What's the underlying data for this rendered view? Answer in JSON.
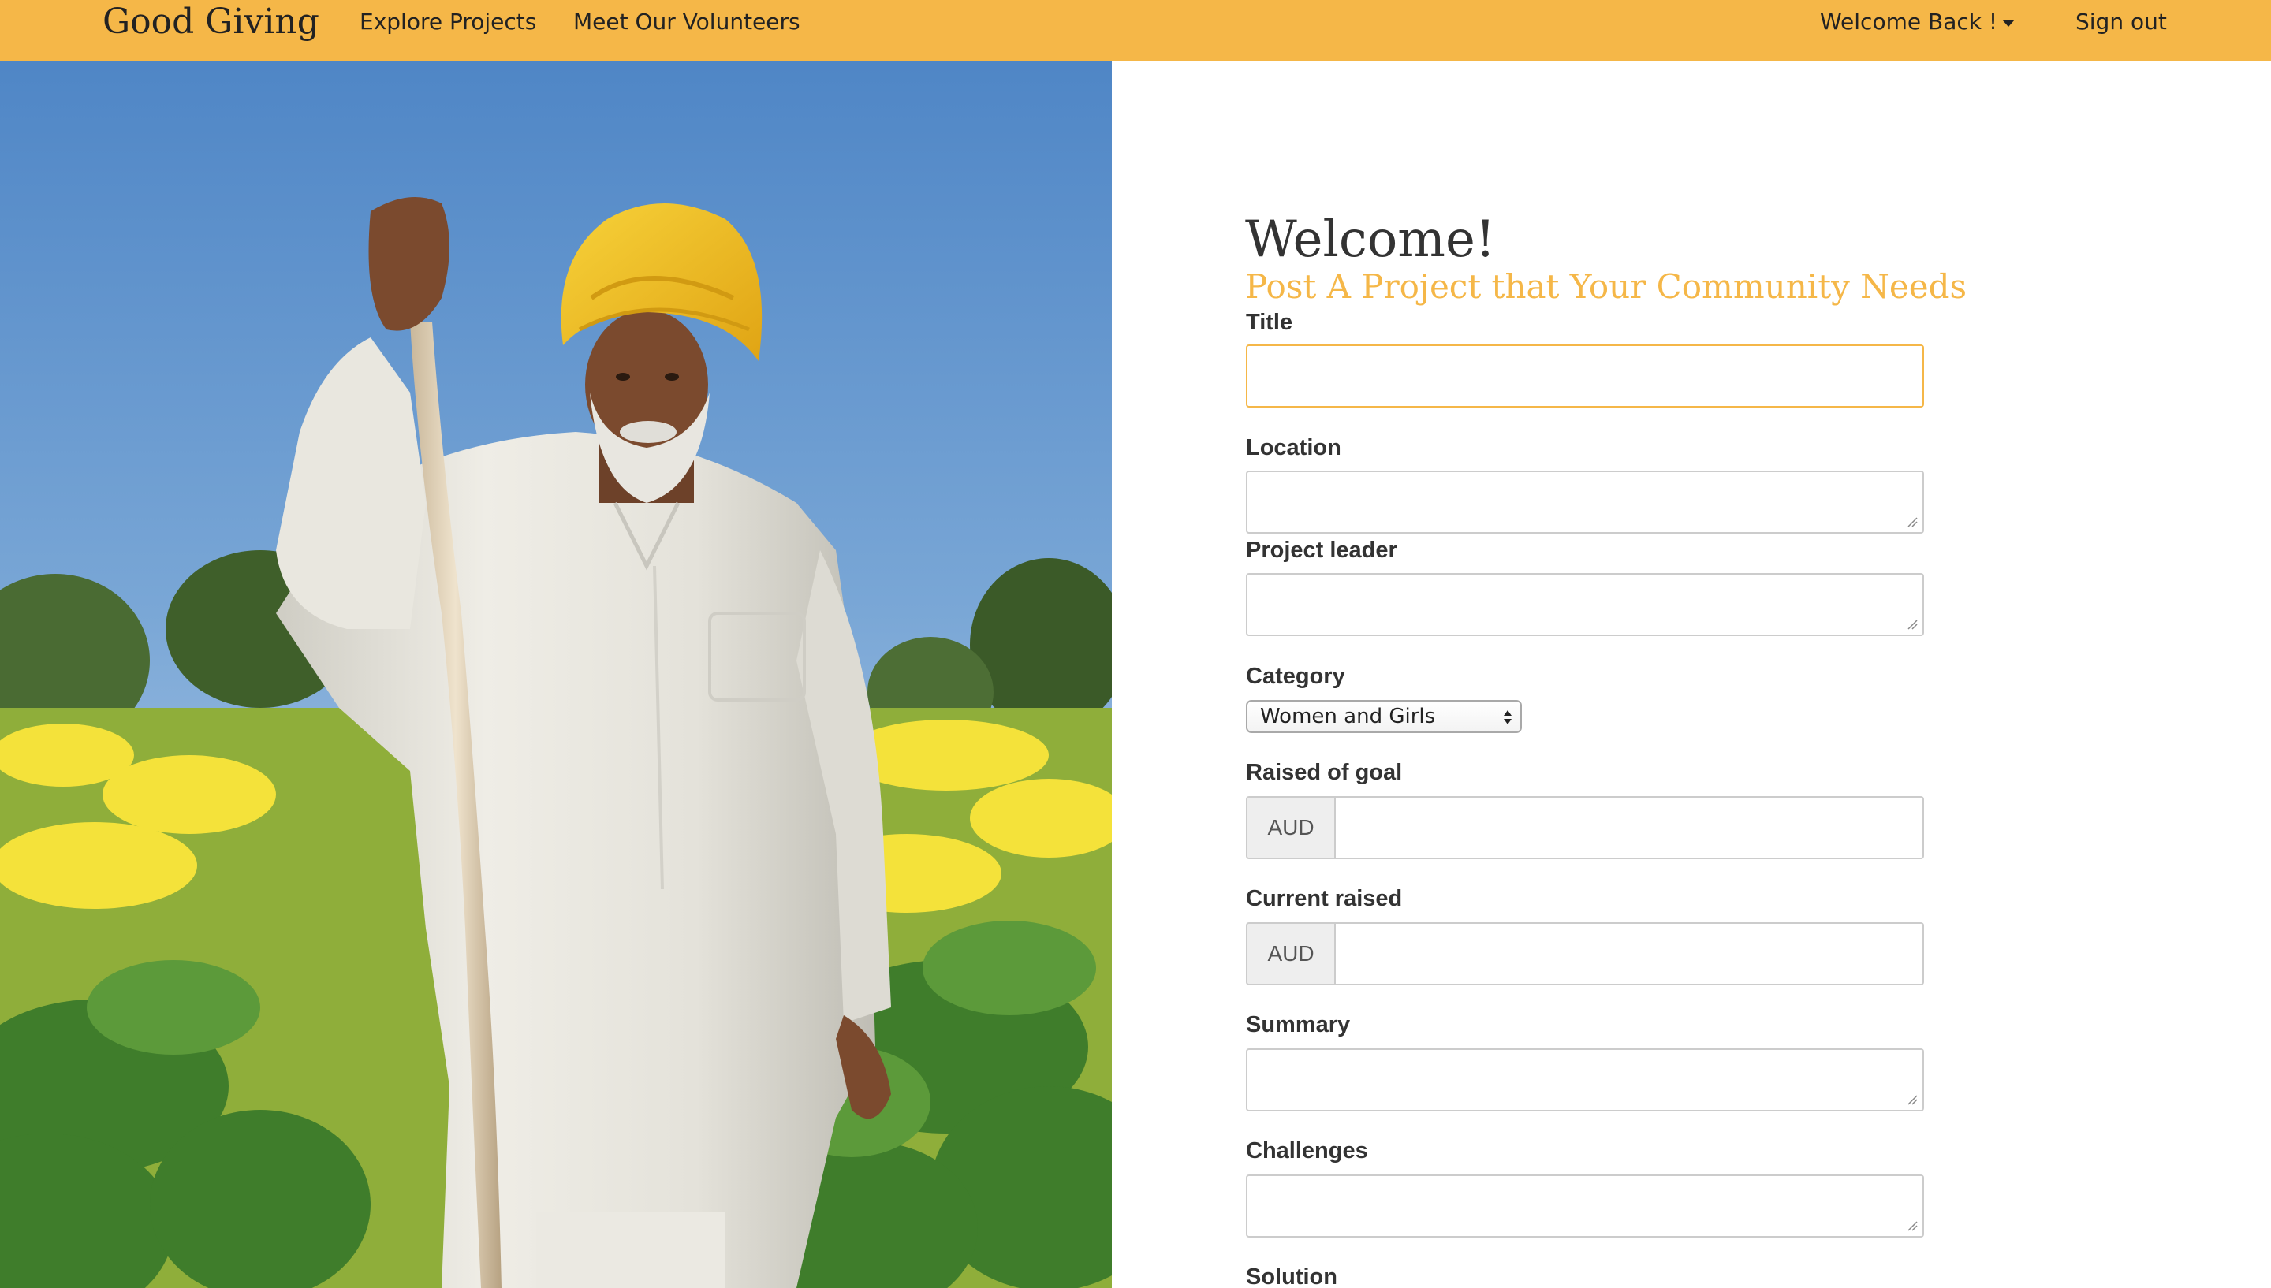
{
  "navbar": {
    "brand": "Good Giving",
    "links": [
      "Explore Projects",
      "Meet Our Volunteers"
    ],
    "welcome": "Welcome Back !",
    "signout": "Sign out"
  },
  "colors": {
    "accent": "#f5b748",
    "text": "#333333"
  },
  "hero": {
    "description_icon": "photo-farmer-mustard-field"
  },
  "form": {
    "heading": "Welcome!",
    "subheading": "Post A Project that Your Community Needs",
    "fields": {
      "title": {
        "label": "Title",
        "value": ""
      },
      "location": {
        "label": "Location",
        "value": ""
      },
      "project_leader": {
        "label": "Project leader",
        "value": ""
      },
      "category": {
        "label": "Category",
        "selected": "Women and Girls"
      },
      "raised_of_goal": {
        "label": "Raised of goal",
        "addon": "AUD",
        "value": ""
      },
      "current_raised": {
        "label": "Current raised",
        "addon": "AUD",
        "value": ""
      },
      "summary": {
        "label": "Summary",
        "value": ""
      },
      "challenges": {
        "label": "Challenges",
        "value": ""
      },
      "solution": {
        "label": "Solution"
      }
    }
  }
}
